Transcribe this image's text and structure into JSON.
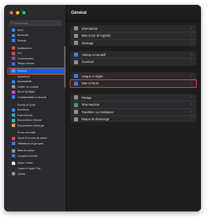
{
  "window": {
    "title": "Général"
  },
  "search": {
    "placeholder": "Rechercher"
  },
  "sidebar": {
    "items": [
      {
        "label": "Wi-Fi",
        "icon": "wifi-icon",
        "color": "#2f80ed"
      },
      {
        "label": "Bluetooth",
        "icon": "bluetooth-icon",
        "color": "#2f80ed"
      },
      {
        "label": "Réseau",
        "icon": "network-icon",
        "color": "#2f80ed"
      },
      {
        "label": "Notifications",
        "icon": "notifications-icon",
        "color": "#e5484d"
      },
      {
        "label": "Son",
        "icon": "sound-icon",
        "color": "#e5484d"
      },
      {
        "label": "Concentration",
        "icon": "focus-icon",
        "color": "#6e56cf"
      },
      {
        "label": "Temps d'écran",
        "icon": "screen-time-icon",
        "color": "#6e56cf"
      },
      {
        "label": "Général",
        "icon": "gear-icon",
        "color": "#8e8e93",
        "selected": true
      },
      {
        "label": "Apparence",
        "icon": "appearance-icon",
        "color": "#2b2b2b"
      },
      {
        "label": "Accessibilité",
        "icon": "accessibility-icon",
        "color": "#2f80ed"
      },
      {
        "label": "Centre de contrôle",
        "icon": "control-center-icon",
        "color": "#8e8e93"
      },
      {
        "label": "Siri et Spotlight",
        "icon": "siri-icon",
        "color": "#c04bd6"
      },
      {
        "label": "Confidentialité et sécurité",
        "icon": "privacy-hand-icon",
        "color": "#2f80ed"
      },
      {
        "label": "Bureau et Dock",
        "icon": "dock-icon",
        "color": "#2b2b2b"
      },
      {
        "label": "Moniteurs",
        "icon": "display-icon",
        "color": "#2f80ed"
      },
      {
        "label": "Fond d'écran",
        "icon": "wallpaper-icon",
        "color": "#2f9ec6"
      },
      {
        "label": "Économiseur d'écran",
        "icon": "screensaver-icon",
        "color": "#39b7c8"
      },
      {
        "label": "Économiseur d'énergie",
        "icon": "energy-icon",
        "color": "#e5a630"
      },
      {
        "label": "Écran verrouillé",
        "icon": "lock-screen-icon",
        "color": "#2b2b2b"
      },
      {
        "label": "Touch ID et mot de passe",
        "icon": "touch-id-icon",
        "color": "#e5484d"
      },
      {
        "label": "Utilisateurs et groupes",
        "icon": "users-icon",
        "color": "#2f80ed"
      },
      {
        "label": "Mots de passe",
        "icon": "key-icon",
        "color": "#8e8e93"
      },
      {
        "label": "Comptes Internet",
        "icon": "at-icon",
        "color": "#2f80ed"
      },
      {
        "label": "Game Center",
        "icon": "game-center-icon",
        "color": "#e0e0e0"
      },
      {
        "label": "Cartes et Apple Pay",
        "icon": "wallet-icon",
        "color": "#2b2b2b"
      },
      {
        "label": "Clavier",
        "icon": "keyboard-icon",
        "color": "#8e8e93"
      }
    ]
  },
  "main": {
    "groups": [
      {
        "rows": [
          {
            "label": "Informations",
            "icon": "info-icon",
            "color": "#8e8e93"
          },
          {
            "label": "Mise à jour de logiciels",
            "icon": "software-update-icon",
            "color": "#8e8e93"
          },
          {
            "label": "Stockage",
            "icon": "storage-icon",
            "color": "#8e8e93"
          }
        ]
      },
      {
        "rows": [
          {
            "label": "AirDrop et Handoff",
            "icon": "airdrop-icon",
            "color": "#2f80ed"
          },
          {
            "label": "Ouverture",
            "icon": "login-items-icon",
            "color": "#8e8e93"
          }
        ]
      },
      {
        "rows": [
          {
            "label": "Langue et région",
            "icon": "globe-icon",
            "color": "#2f80ed"
          },
          {
            "label": "Date et heure",
            "icon": "calendar-clock-icon",
            "color": "#2f80ed",
            "highlight": true
          }
        ]
      },
      {
        "rows": [
          {
            "label": "Partage",
            "icon": "sharing-icon",
            "color": "#8e8e93"
          },
          {
            "label": "Time Machine",
            "icon": "time-machine-icon",
            "color": "#3aa56a"
          },
          {
            "label": "Transférer ou réinitialiser",
            "icon": "reset-icon",
            "color": "#8e8e93"
          },
          {
            "label": "Disque de démarrage",
            "icon": "startup-disk-icon",
            "color": "#8e8e93"
          }
        ]
      }
    ]
  }
}
